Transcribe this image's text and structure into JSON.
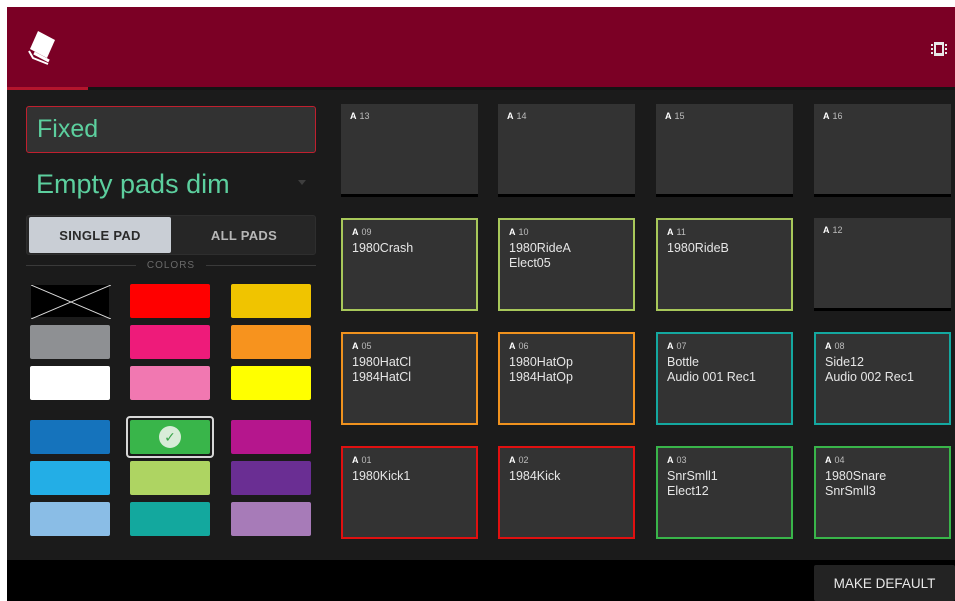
{
  "header": {
    "logo_icon": "pads-logo-icon",
    "right_icon": "chip-icon",
    "accent_color": "#7b0025",
    "progress_fraction": 0.085
  },
  "left_panel": {
    "mode_value": "Fixed",
    "option_value": "Empty pads dim",
    "segmented": {
      "single_label": "SINGLE PAD",
      "all_label": "ALL PADS",
      "active": "single"
    },
    "colors_label": "COLORS",
    "swatches": [
      {
        "color": "none"
      },
      {
        "color": "#ff0000"
      },
      {
        "color": "#f0c400"
      },
      {
        "color": "#8e9093"
      },
      {
        "color": "#ee1b7a"
      },
      {
        "color": "#f7931e"
      },
      {
        "color": "#ffffff"
      },
      {
        "color": "#f178b1"
      },
      {
        "color": "#ffff00"
      },
      {
        "color": "#1573bc"
      },
      {
        "color": "#39b54a",
        "selected": true
      },
      {
        "color": "#b5168d"
      },
      {
        "color": "#23aee6"
      },
      {
        "color": "#aed462"
      },
      {
        "color": "#6a2e93"
      },
      {
        "color": "#8abde6"
      },
      {
        "color": "#13a89e"
      },
      {
        "color": "#a77bb8"
      }
    ]
  },
  "pads": [
    {
      "bank": "A",
      "num": "13",
      "name": "",
      "color": "#000000"
    },
    {
      "bank": "A",
      "num": "14",
      "name": "",
      "color": "#000000"
    },
    {
      "bank": "A",
      "num": "15",
      "name": "",
      "color": "#000000"
    },
    {
      "bank": "A",
      "num": "16",
      "name": "",
      "color": "#000000"
    },
    {
      "bank": "A",
      "num": "09",
      "name": "1980Crash",
      "color": "#a8c85a"
    },
    {
      "bank": "A",
      "num": "10",
      "name": "1980RideA\nElect05",
      "color": "#a8c85a"
    },
    {
      "bank": "A",
      "num": "11",
      "name": "1980RideB",
      "color": "#a8c85a"
    },
    {
      "bank": "A",
      "num": "12",
      "name": "",
      "color": "#000000"
    },
    {
      "bank": "A",
      "num": "05",
      "name": "1980HatCl\n1984HatCl",
      "color": "#f0921e"
    },
    {
      "bank": "A",
      "num": "06",
      "name": "1980HatOp\n1984HatOp",
      "color": "#f0921e"
    },
    {
      "bank": "A",
      "num": "07",
      "name": "Bottle\nAudio 001 Rec1",
      "color": "#14a8a0"
    },
    {
      "bank": "A",
      "num": "08",
      "name": "Side12\nAudio 002 Rec1",
      "color": "#14a8a0"
    },
    {
      "bank": "A",
      "num": "01",
      "name": "1980Kick1",
      "color": "#e01010"
    },
    {
      "bank": "A",
      "num": "02",
      "name": "1984Kick",
      "color": "#e01010"
    },
    {
      "bank": "A",
      "num": "03",
      "name": "SnrSmll1\nElect12",
      "color": "#39b54a"
    },
    {
      "bank": "A",
      "num": "04",
      "name": "1980Snare\nSnrSmll3",
      "color": "#39b54a"
    }
  ],
  "footer": {
    "make_default_label": "MAKE DEFAULT"
  }
}
